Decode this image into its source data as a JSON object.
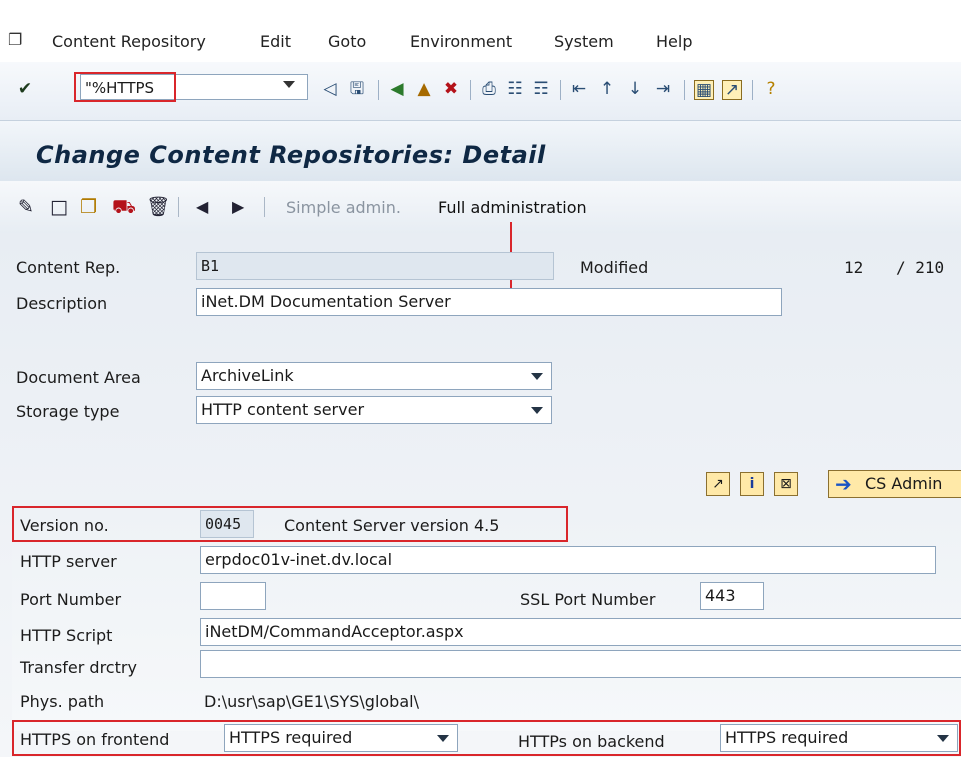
{
  "menubar": {
    "items": [
      "Content Repository",
      "Edit",
      "Goto",
      "Environment",
      "System",
      "Help"
    ]
  },
  "toolbar": {
    "command_value": "\"%HTTPS",
    "icons": [
      "check-icon",
      "back-icon",
      "save-icon",
      "nav-back-icon",
      "exit-icon",
      "cancel-icon",
      "print-icon",
      "find-icon",
      "find-next-icon",
      "first-page-icon",
      "prev-page-icon",
      "next-page-icon",
      "last-page-icon",
      "new-session-icon",
      "shortcut-icon",
      "help-icon"
    ]
  },
  "title": "Change Content Repositories: Detail",
  "app_toolbar": {
    "simple_admin": "Simple admin.",
    "full_admin": "Full administration"
  },
  "form": {
    "content_rep": {
      "label": "Content Rep.",
      "value": "B1"
    },
    "modified": {
      "label": "Modified",
      "count": "12",
      "total": "/ 210"
    },
    "description": {
      "label": "Description",
      "value": "iNet.DM Documentation Server"
    },
    "document_area": {
      "label": "Document Area",
      "value": "ArchiveLink"
    },
    "storage_type": {
      "label": "Storage type",
      "value": "HTTP content server"
    },
    "cs_admin": "CS Admin",
    "version": {
      "label": "Version no.",
      "value": "0045",
      "text": "Content Server version 4.5"
    },
    "http_server": {
      "label": "HTTP server",
      "value": "erpdoc01v-inet.dv.local"
    },
    "port": {
      "label": "Port Number",
      "value": ""
    },
    "ssl_port": {
      "label": "SSL Port Number",
      "value": "443"
    },
    "http_script": {
      "label": "HTTP Script",
      "value": "iNetDM/CommandAcceptor.aspx"
    },
    "transfer": {
      "label": "Transfer drctry",
      "value": ""
    },
    "phys_path": {
      "label": "Phys. path",
      "value": "D:\\usr\\sap\\GE1\\SYS\\global\\"
    },
    "https_frontend": {
      "label": "HTTPS on frontend",
      "value": "HTTPS required"
    },
    "https_backend": {
      "label": "HTTPs on backend",
      "value": "HTTPS required"
    }
  },
  "colors": {
    "highlight": "#d9262b",
    "title": "#0f2844"
  }
}
